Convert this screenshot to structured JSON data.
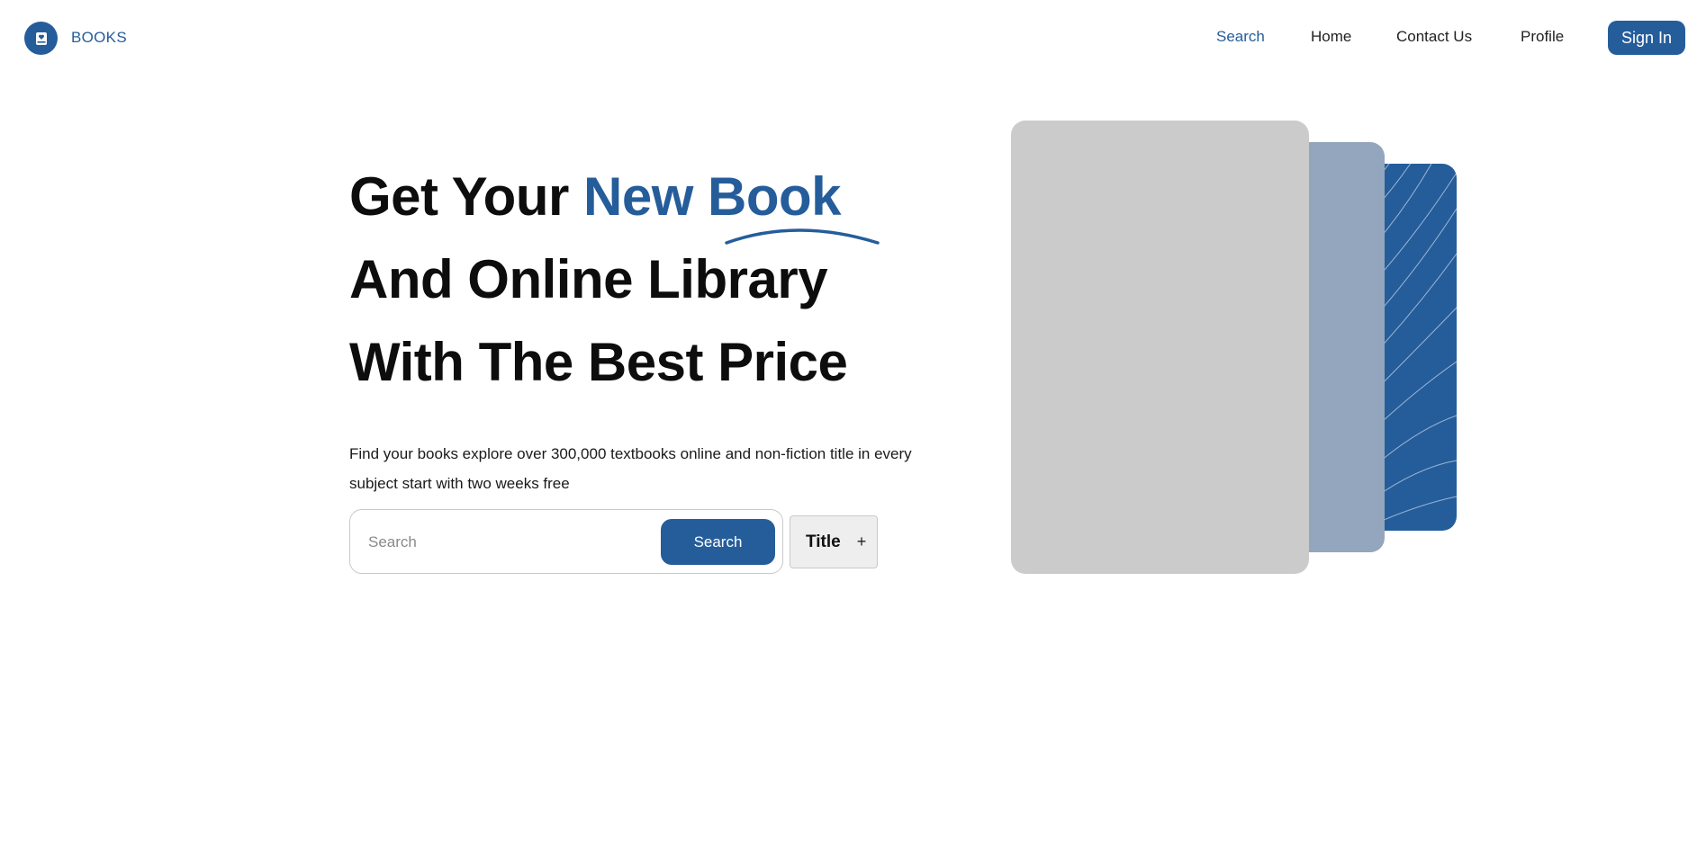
{
  "nav": {
    "brand": "BOOKS",
    "links": [
      "Search",
      "Home",
      "Contact Us",
      "Profile"
    ],
    "active": "Search",
    "signin": "Sign In"
  },
  "hero": {
    "line1_prefix": "Get Your ",
    "line1_accent": "New Book",
    "line2": "And Online Library",
    "line3": "With The Best Price",
    "description": "Find your books explore over 300,000 textbooks online and non-fiction title in every subject start with two weeks free"
  },
  "search": {
    "placeholder": "Search",
    "button": "Search",
    "filter_label": "Title",
    "filter_icon": "+"
  },
  "colors": {
    "accent": "#255d9b",
    "card_light": "#cbcbcb",
    "card_mid": "#94a6bd"
  },
  "icons": {
    "logo": "book-icon",
    "filter": "plus-icon"
  }
}
